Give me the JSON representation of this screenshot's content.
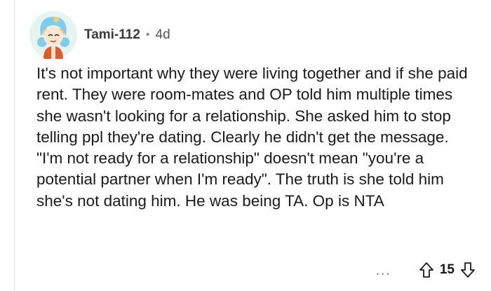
{
  "comment": {
    "author": "Tami-112",
    "separator": "•",
    "age": "4d",
    "body": "It's not important why they were living together and if she paid rent. They were room-mates and OP told him multiple times she wasn't looking for a relationship. She asked him to stop telling ppl they're dating. Clearly he didn't get the message. \"I'm not ready for a relationship\" doesn't mean \"you're a potential partner when I'm ready\". The truth is she told him she's not dating him. He was being TA. Op is NTA",
    "score": "15",
    "more_label": "..."
  },
  "icons": {
    "avatar": "avatar-icon",
    "upvote": "upvote-arrow-icon",
    "downvote": "downvote-arrow-icon",
    "more": "more-options-icon"
  },
  "colors": {
    "accent_avatar_bg": "#e3f3ef",
    "meta_gray": "#878a8c",
    "text": "#1a1a1b"
  }
}
